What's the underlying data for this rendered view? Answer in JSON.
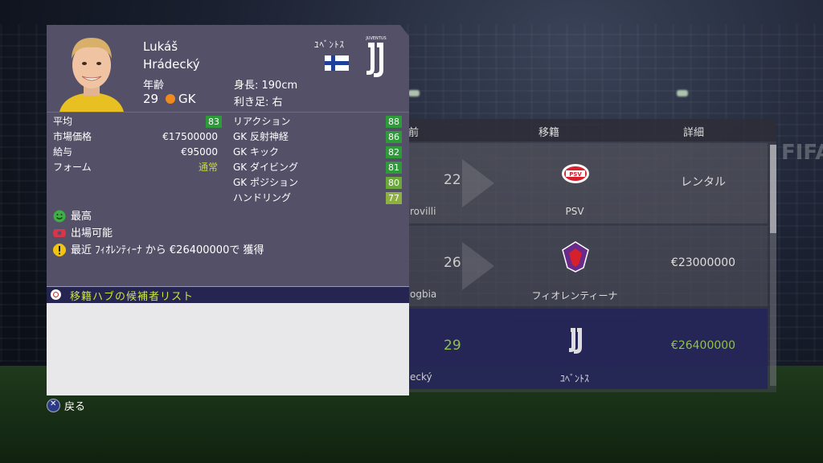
{
  "player": {
    "first_name": "Lukáš",
    "last_name": "Hrádecký",
    "age_label": "年齢",
    "age": "29",
    "position": "GK",
    "height": "身長: 190cm",
    "foot": "利き足: 右",
    "club": "ﾕﾍﾞﾝﾄｽ",
    "club_logo_text": "JUVENTUS"
  },
  "stats_left": [
    {
      "label": "平均",
      "value": "83",
      "type": "badge",
      "color": "#2f9a3a"
    },
    {
      "label": "市場価格",
      "value": "€17500000",
      "type": "text"
    },
    {
      "label": "給与",
      "value": "€95000",
      "type": "text"
    },
    {
      "label": "フォーム",
      "value": "通常",
      "type": "text",
      "color": "#c8d93a"
    }
  ],
  "stats_right": [
    {
      "label": "リアクション",
      "value": "88",
      "color": "#2f9a3a"
    },
    {
      "label": "GK 反射神経",
      "value": "86",
      "color": "#2f9a3a"
    },
    {
      "label": "GK キック",
      "value": "82",
      "color": "#2f9a3a"
    },
    {
      "label": "GK ダイビング",
      "value": "81",
      "color": "#2f9a3a"
    },
    {
      "label": "GK ポジション",
      "value": "80",
      "color": "#6aa83a"
    },
    {
      "label": "ハンドリング",
      "value": "77",
      "color": "#8db040"
    }
  ],
  "status": [
    {
      "icon": "smile-icon",
      "text": "最高",
      "color": "#3cb043"
    },
    {
      "icon": "ticket-icon",
      "text": "出場可能",
      "color": "#d8344a"
    },
    {
      "icon": "alert-icon",
      "text": "最近 ﾌｨｵﾚﾝﾃｨｰﾅ から €26400000で 獲得",
      "color": "#f1c40f"
    }
  ],
  "list_title": "移籍ハブの候補者リスト",
  "back_label": "戻る",
  "background_list": {
    "col_name": "前",
    "col_transfer": "移籍",
    "col_detail": "詳細",
    "rows": [
      {
        "name": "rovilli",
        "number": "22",
        "club": "PSV",
        "detail": "レンタル"
      },
      {
        "name": "ogbia",
        "number": "26",
        "club": "フィオレンティーナ",
        "detail": "€23000000"
      },
      {
        "name": "ecký",
        "number": "29",
        "club": "ﾕﾍﾞﾝﾄｽ",
        "detail": "€26400000"
      }
    ]
  },
  "fifa_logo": "FIFA"
}
